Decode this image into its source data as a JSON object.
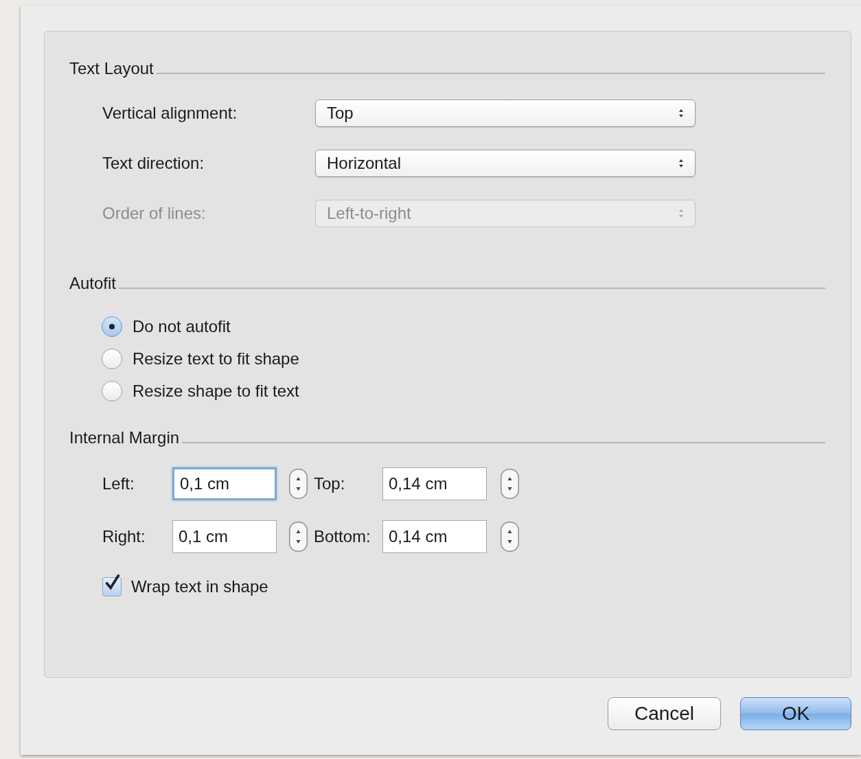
{
  "text_layout": {
    "title": "Text Layout",
    "fields": [
      {
        "label": "Vertical alignment:",
        "value": "Top",
        "disabled": false
      },
      {
        "label": "Text direction:",
        "value": "Horizontal",
        "disabled": false
      },
      {
        "label": "Order of lines:",
        "value": "Left-to-right",
        "disabled": true
      }
    ]
  },
  "autofit": {
    "title": "Autofit",
    "options": [
      {
        "label": "Do not autofit",
        "selected": true
      },
      {
        "label": "Resize text to fit shape",
        "selected": false
      },
      {
        "label": "Resize shape to fit text",
        "selected": false
      }
    ]
  },
  "internal_margin": {
    "title": "Internal Margin",
    "fields": [
      {
        "label": "Left:",
        "value": "0,1 cm",
        "focused": true
      },
      {
        "label": "Top:",
        "value": "0,14 cm",
        "focused": false
      },
      {
        "label": "Right:",
        "value": "0,1 cm",
        "focused": false
      },
      {
        "label": "Bottom:",
        "value": "0,14 cm",
        "focused": false
      }
    ],
    "wrap": {
      "label": "Wrap text in shape",
      "checked": true
    }
  },
  "buttons": [
    {
      "label": "Cancel",
      "default": false
    },
    {
      "label": "OK",
      "default": true
    }
  ]
}
